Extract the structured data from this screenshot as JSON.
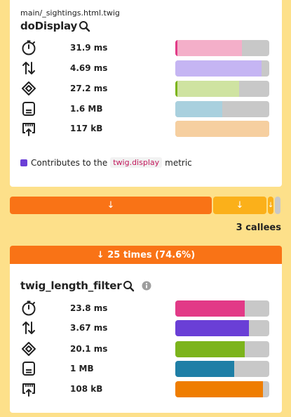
{
  "caller": {
    "path": "main/_sightings.html.twig",
    "name": "doDisplay",
    "metrics": [
      {
        "icon": "stopwatch-icon",
        "value": "31.9 ms",
        "fraction": 0.71,
        "fill_color": "#f4afc9",
        "mark_color": "#e23a87"
      },
      {
        "icon": "up-down-arrows-icon",
        "value": "4.69 ms",
        "fraction": 0.92,
        "fill_color": "#c5b5f3",
        "mark_color": "#c5b5f3"
      },
      {
        "icon": "cpu-chip-icon",
        "value": "27.2 ms",
        "fraction": 0.68,
        "fill_color": "#cfe3a1",
        "mark_color": "#7cb41c"
      },
      {
        "icon": "memory-icon",
        "value": "1.6 MB",
        "fraction": 0.5,
        "fill_color": "#a9d0de",
        "mark_color": "#a9d0de"
      },
      {
        "icon": "network-upload-icon",
        "value": "117 kB",
        "fraction": 1.0,
        "fill_color": "#f6cfa0",
        "mark_color": "#f6cfa0"
      }
    ],
    "legend": {
      "prefix": "Contributes to the",
      "metric_name": "twig.display",
      "suffix": "metric",
      "color": "#6a3fd6"
    }
  },
  "call_bars": [
    {
      "symbol": "↓",
      "color": "#f97316"
    },
    {
      "symbol": "↓",
      "color": "#fbb01a"
    },
    {
      "symbol": "↓",
      "color": "#fbb01a"
    },
    {
      "symbol": "",
      "color": "#c8c8c8"
    }
  ],
  "callees_label": "3 callees",
  "callee": {
    "times_label": "↓ 25 times (74.6%)",
    "name": "twig_length_filter",
    "metrics": [
      {
        "icon": "stopwatch-icon",
        "value": "23.8 ms",
        "fraction": 0.74,
        "fill_color": "#e23a87",
        "mark_color": "#e23a87"
      },
      {
        "icon": "up-down-arrows-icon",
        "value": "3.67 ms",
        "fraction": 0.78,
        "fill_color": "#6a3fd6",
        "mark_color": "#6a3fd6"
      },
      {
        "icon": "cpu-chip-icon",
        "value": "20.1 ms",
        "fraction": 0.74,
        "fill_color": "#7cb41c",
        "mark_color": "#7cb41c"
      },
      {
        "icon": "memory-icon",
        "value": "1 MB",
        "fraction": 0.63,
        "fill_color": "#1f7fa6",
        "mark_color": "#1f7fa6"
      },
      {
        "icon": "network-upload-icon",
        "value": "108 kB",
        "fraction": 0.93,
        "fill_color": "#ef7d00",
        "mark_color": "#ef7d00"
      }
    ]
  }
}
